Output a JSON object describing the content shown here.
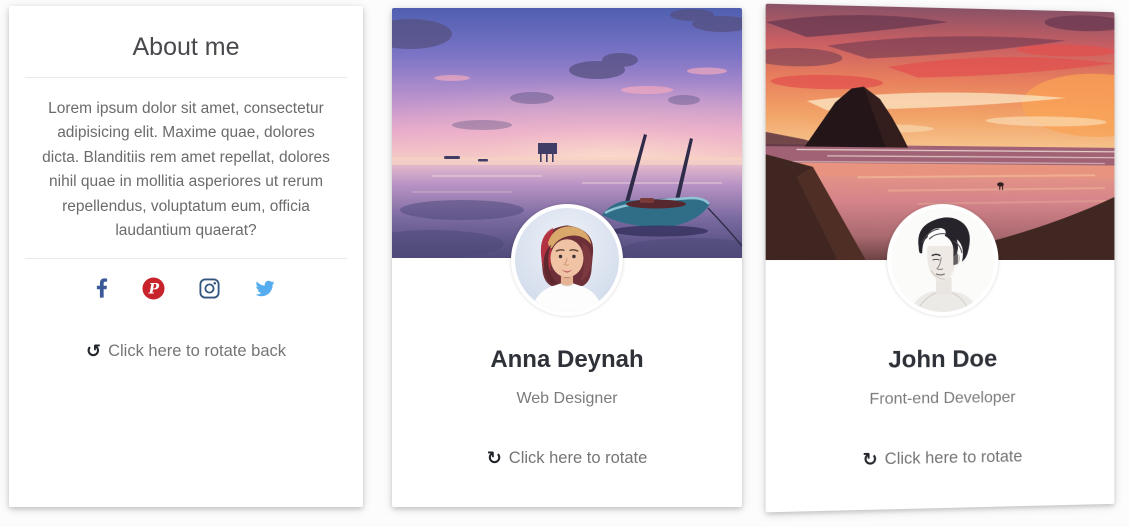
{
  "cards": {
    "about": {
      "title": "About me",
      "body": "Lorem ipsum dolor sit amet, consectetur adipisicing elit. Maxime quae, dolores dicta. Blanditiis rem amet repellat, dolores nihil quae in mollitia asperiores ut rerum repellendus, voluptatum eum, officia laudantium quaerat?",
      "social": [
        {
          "icon": "facebook-icon",
          "color": "#3b5998"
        },
        {
          "icon": "pinterest-icon",
          "color": "#c8232c",
          "glyph": "P"
        },
        {
          "icon": "instagram-icon",
          "color": "#33567f"
        },
        {
          "icon": "twitter-icon",
          "color": "#55acee"
        }
      ],
      "rotate_back": {
        "icon_glyph": "↺",
        "label": "Click here to rotate back"
      }
    },
    "anna": {
      "name": "Anna Deynah",
      "occupation": "Web Designer",
      "rotate": {
        "icon_glyph": "↻",
        "label": "Click here to rotate"
      },
      "cover": "sunset-lake-boat-photo",
      "avatar": "woman-portrait-photo"
    },
    "john": {
      "name": "John Doe",
      "occupation": "Front-end Developer",
      "rotate": {
        "icon_glyph": "↻",
        "label": "Click here to rotate"
      },
      "cover": "sunset-beach-rock-photo",
      "avatar": "man-sketch-portrait"
    }
  },
  "colors": {
    "page_bg": "#fcfcfc",
    "card_bg": "#ffffff",
    "heading_text": "#47494d",
    "name_text": "#2e3238",
    "muted_text": "#757575",
    "divider": "#e9e9e9",
    "rotate_icon": "#212529"
  }
}
